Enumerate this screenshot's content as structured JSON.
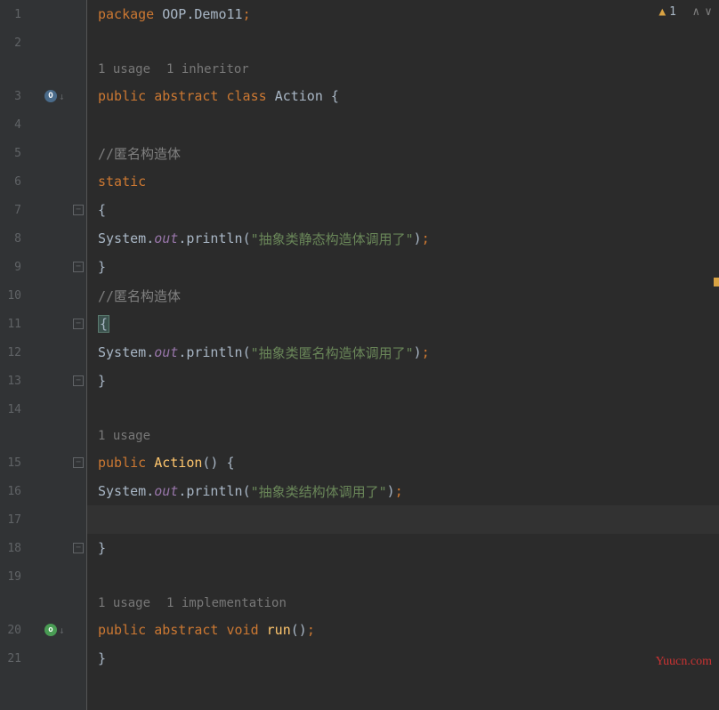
{
  "warning": {
    "count": "1"
  },
  "hints": {
    "usage1": "1 usage",
    "inheritor1": "1 inheritor",
    "usage2": "1 usage",
    "usage3": "1 usage",
    "impl1": "1 implementation"
  },
  "lines": {
    "l1": {
      "num": "1",
      "kw": "package ",
      "pkg": "OOP.Demo11",
      "semi": ";"
    },
    "l2": {
      "num": "2"
    },
    "l3": {
      "num": "3",
      "kw": "public abstract class ",
      "cls": "Action ",
      "brace": "{"
    },
    "l4": {
      "num": "4"
    },
    "l5": {
      "num": "5",
      "comment": "//匿名构造体"
    },
    "l6": {
      "num": "6",
      "kw": "static"
    },
    "l7": {
      "num": "7",
      "brace": "{"
    },
    "l8": {
      "num": "8",
      "sys": "System",
      "dot1": ".",
      "out": "out",
      "dot2": ".",
      "method": "println",
      "paren1": "(",
      "str": "\"抽象类静态构造体调用了\"",
      "paren2": ")",
      "semi": ";"
    },
    "l9": {
      "num": "9",
      "brace": "}"
    },
    "l10": {
      "num": "10",
      "comment": "//匿名构造体"
    },
    "l11": {
      "num": "11",
      "brace": "{"
    },
    "l12": {
      "num": "12",
      "sys": "System",
      "dot1": ".",
      "out": "out",
      "dot2": ".",
      "method": "println",
      "paren1": "(",
      "str": "\"抽象类匿名构造体调用了\"",
      "paren2": ")",
      "semi": ";"
    },
    "l13": {
      "num": "13",
      "brace": "}"
    },
    "l14": {
      "num": "14"
    },
    "l15": {
      "num": "15",
      "kw": "public ",
      "method": "Action",
      "paren": "() ",
      "brace": "{"
    },
    "l16": {
      "num": "16",
      "sys": "System",
      "dot1": ".",
      "out": "out",
      "dot2": ".",
      "method": "println",
      "paren1": "(",
      "str": "\"抽象类结构体调用了\"",
      "paren2": ")",
      "semi": ";"
    },
    "l17": {
      "num": "17"
    },
    "l18": {
      "num": "18",
      "brace": "}"
    },
    "l19": {
      "num": "19"
    },
    "l20": {
      "num": "20",
      "kw": "public abstract void ",
      "method": "run",
      "paren": "()",
      "semi": ";"
    },
    "l21": {
      "num": "21",
      "brace": "}"
    }
  },
  "watermark": "Yuucn.com"
}
